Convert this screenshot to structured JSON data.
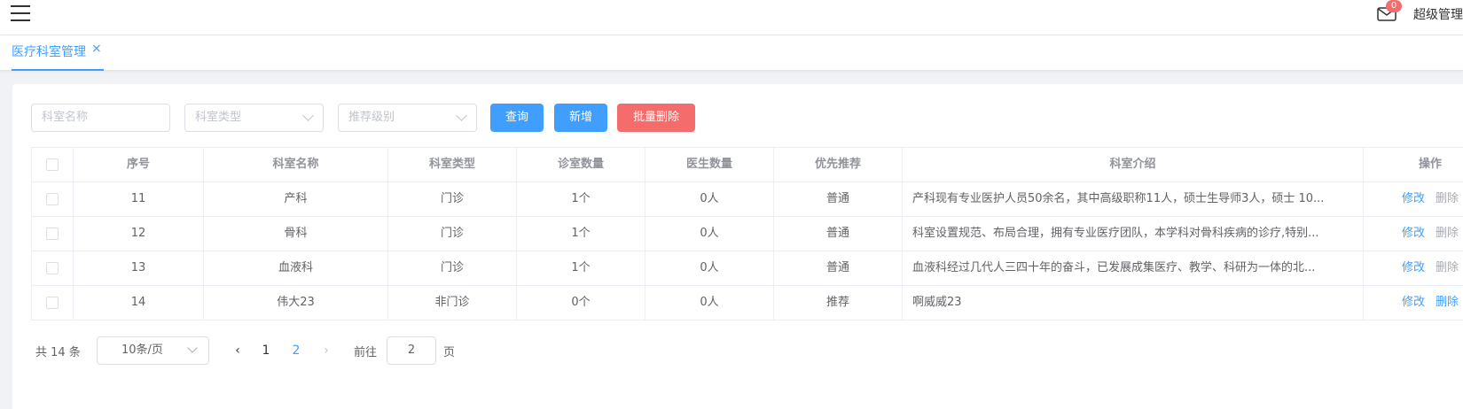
{
  "header": {
    "mail_badge": "0",
    "user_name": "超级管理"
  },
  "tabs": [
    {
      "label": "医疗科室管理",
      "close": "×"
    }
  ],
  "filters": {
    "name_placeholder": "科室名称",
    "type_placeholder": "科室类型",
    "level_placeholder": "推荐级别",
    "query_label": "查询",
    "add_label": "新增",
    "batch_delete_label": "批量删除"
  },
  "table": {
    "columns": [
      "序号",
      "科室名称",
      "科室类型",
      "诊室数量",
      "医生数量",
      "优先推荐",
      "科室介绍",
      "操作"
    ],
    "rows": [
      {
        "id": "11",
        "name": "产科",
        "type": "门诊",
        "rooms": "1个",
        "doctors": "0人",
        "priority": "普通",
        "intro": "产科现有专业医护人员50余名，其中高级职称11人，硕士生导师3人，硕士 10...",
        "edit": "修改",
        "delete": "删除",
        "delete_enabled": false
      },
      {
        "id": "12",
        "name": "骨科",
        "type": "门诊",
        "rooms": "1个",
        "doctors": "0人",
        "priority": "普通",
        "intro": "科室设置规范、布局合理，拥有专业医疗团队，本学科对骨科疾病的诊疗,特别...",
        "edit": "修改",
        "delete": "删除",
        "delete_enabled": false
      },
      {
        "id": "13",
        "name": "血液科",
        "type": "门诊",
        "rooms": "1个",
        "doctors": "0人",
        "priority": "普通",
        "intro": "血液科经过几代人三四十年的奋斗，已发展成集医疗、教学、科研为一体的北...",
        "edit": "修改",
        "delete": "删除",
        "delete_enabled": false
      },
      {
        "id": "14",
        "name": "伟大23",
        "type": "非门诊",
        "rooms": "0个",
        "doctors": "0人",
        "priority": "推荐",
        "intro": "啊威威23",
        "edit": "修改",
        "delete": "删除",
        "delete_enabled": true
      }
    ]
  },
  "pagination": {
    "total_text": "共 14 条",
    "page_size": "10条/页",
    "pages": [
      "1",
      "2"
    ],
    "current_page": "2",
    "goto_label": "前往",
    "goto_value": "2",
    "goto_suffix": "页",
    "prev_icon": "‹",
    "next_icon": "›"
  },
  "colors": {
    "primary": "#409eff",
    "danger": "#f56c6c",
    "disabled": "#a8abb2"
  }
}
